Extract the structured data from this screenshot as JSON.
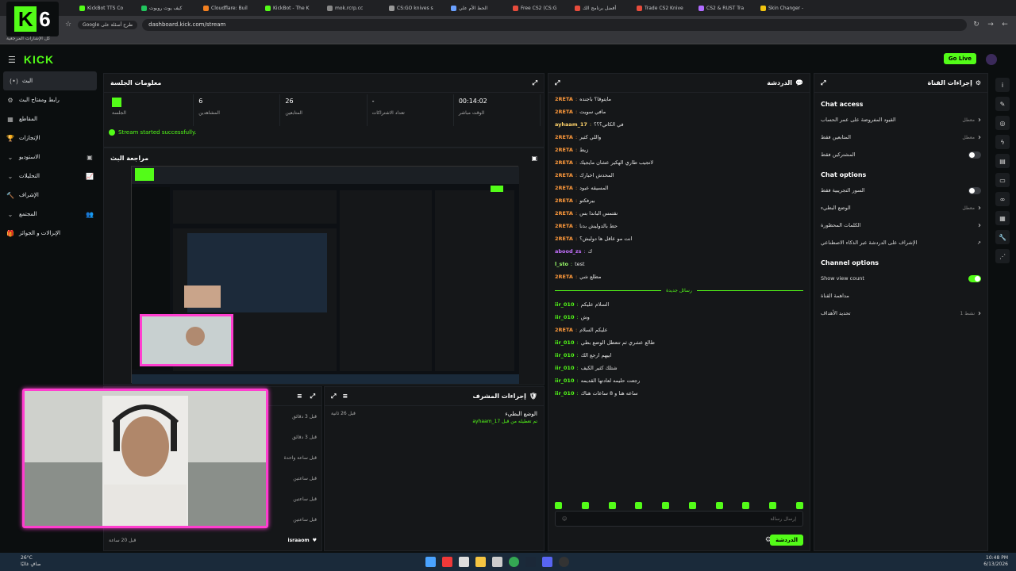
{
  "browser": {
    "tabs": [
      {
        "label": "KickBot TTS Co",
        "color": "#53fc18"
      },
      {
        "label": "كيف يوت روبوت",
        "color": "#21c55d"
      },
      {
        "label": "Cloudflare: Buil",
        "color": "#f38020"
      },
      {
        "label": "KickBot - The K",
        "color": "#53fc18"
      },
      {
        "label": "mok.rcrp.cc",
        "color": "#888888"
      },
      {
        "label": "CS:GO knives s",
        "color": "#999999"
      },
      {
        "label": "الحظ الأم علي",
        "color": "#6aa0ff"
      },
      {
        "label": "Free CS2 (CS:G",
        "color": "#e74c3c"
      },
      {
        "label": "أفضل برنامج الك",
        "color": "#e74c3c"
      },
      {
        "label": "Trade CS2 Knive",
        "color": "#e74c3c"
      },
      {
        "label": "CS2 & RUST Tra",
        "color": "#b06bff"
      },
      {
        "label": "Skin Changer -",
        "color": "#f1c40f"
      }
    ],
    "url": "dashboard.kick.com/stream",
    "google_hint": "Google طرح أسئلة على",
    "bookmarks_label": "كل الإشارات المرجعية"
  },
  "overlay_logo": {
    "letter": "K",
    "number": "6"
  },
  "topbar": {
    "brand": "KICK",
    "golive": "Go Live"
  },
  "sidebar": {
    "items": [
      {
        "label": "البث",
        "icon": "(•)",
        "active": true,
        "chevron": false
      },
      {
        "label": "رابط ومفتاح البث",
        "icon": "⚙",
        "chevron": false
      },
      {
        "label": "المقاطع",
        "icon": "▦",
        "chevron": false
      },
      {
        "label": "الإنجازات",
        "icon": "🏆",
        "chevron": false
      },
      {
        "label": "الاستوديو",
        "icon": "▣",
        "chevron": true
      },
      {
        "label": "التحليلات",
        "icon": "📈",
        "chevron": true
      },
      {
        "label": "الإشراف",
        "icon": "🔨",
        "chevron": false
      },
      {
        "label": "المجتمع",
        "icon": "👥",
        "chevron": true
      },
      {
        "label": "الإنزالات و الجوائز",
        "icon": "🎁",
        "chevron": false
      }
    ]
  },
  "session": {
    "title": "معلومات الجلسة",
    "stats": [
      {
        "value": "",
        "label": "الجلسة"
      },
      {
        "value": "6",
        "label": "المشاهدين"
      },
      {
        "value": "26",
        "label": "المتابعين"
      },
      {
        "value": "-",
        "label": "تعداد الاشتراكات"
      },
      {
        "value": "00:14:02",
        "label": "الوقت مباشر"
      }
    ],
    "success": "Stream started successfully."
  },
  "preview": {
    "title": "مراجعة البث"
  },
  "events_panel": {
    "rows": [
      {
        "time": "قبل 3 دقائق"
      },
      {
        "time": "قبل 3 دقائق"
      },
      {
        "time": "قبل ساعة واحدة"
      },
      {
        "time": "قبل ساعتين"
      },
      {
        "time": "قبل ساعتين"
      },
      {
        "time": "قبل ساعتين"
      }
    ],
    "last_user": "israaom",
    "last_time": "قبل 20 ساعة"
  },
  "mod_actions": {
    "title": "إجراءات المشرف",
    "item_title": "الوضع البطيء",
    "item_sub": "ayhaam_17 تم تعطيله من قبل",
    "item_time": "قبل 26 ثانية"
  },
  "chat": {
    "title": "الدردشة",
    "messages": [
      {
        "user": "2RETA",
        "text": "مايتوقا؟ باجنده",
        "color": "#ff9a3c"
      },
      {
        "user": "2RETA",
        "text": "مافي سويت",
        "color": "#ff9a3c"
      },
      {
        "user": "ayhaam_17",
        "text": "في الكاتي؟؟؟",
        "color": "#ffd36b"
      },
      {
        "user": "2RETA",
        "text": "واللي كثير",
        "color": "#ff9a3c"
      },
      {
        "user": "2RETA",
        "text": "زيط",
        "color": "#ff9a3c"
      },
      {
        "user": "2RETA",
        "text": "لاتجيب طاري الهكير عشان مايجيك",
        "color": "#ff9a3c"
      },
      {
        "user": "2RETA",
        "text": "المحدش اخبارك",
        "color": "#ff9a3c"
      },
      {
        "user": "2RETA",
        "text": "المسيقه عبود",
        "color": "#ff9a3c"
      },
      {
        "user": "2RETA",
        "text": "بيرفكتو",
        "color": "#ff9a3c"
      },
      {
        "user": "2RETA",
        "text": "نقتمس الباندا بس",
        "color": "#ff9a3c"
      },
      {
        "user": "2RETA",
        "text": "حط بالدوليش بدنا",
        "color": "#ff9a3c"
      },
      {
        "user": "2RETA",
        "text": "انت مو عاقل ها دوليش؟",
        "color": "#ff9a3c"
      },
      {
        "user": "abood_zs",
        "text": "ك",
        "color": "#c471ff"
      },
      {
        "user": "l_sto",
        "text": "test",
        "color": "#9cff6b"
      },
      {
        "user": "2RETA",
        "text": "مطلع شي",
        "color": "#ff9a3c"
      }
    ],
    "divider": "رسائل جديدة",
    "new_messages": [
      {
        "user": "iir_010",
        "text": "السلام عليكم",
        "color": "#53fc18"
      },
      {
        "user": "iir_010",
        "text": "وش",
        "color": "#53fc18"
      },
      {
        "user": "2RETA",
        "text": "عليكم السلام",
        "color": "#ff9a3c"
      },
      {
        "user": "iir_010",
        "text": "طالع عشري ثم تتعطل الوضع بطي",
        "color": "#53fc18"
      },
      {
        "user": "iir_010",
        "text": "ابيهم ارجع الك",
        "color": "#53fc18"
      },
      {
        "user": "iir_010",
        "text": "شتلك كثير الكيف",
        "color": "#53fc18"
      },
      {
        "user": "iir_010",
        "text": "رجعت حليمه لعادتها القديمه",
        "color": "#53fc18"
      },
      {
        "user": "iir_010",
        "text": "ساعه هنا و 8 ساعات هناك",
        "color": "#53fc18"
      }
    ],
    "input_placeholder": "إرسال رسالة",
    "send_label": "الدردشة"
  },
  "channel": {
    "title": "إجراءات القناة",
    "sections": [
      {
        "heading": "Chat access",
        "options": [
          {
            "label": "القيود المفروضة على عمر الحساب",
            "right": "معطل",
            "type": "chevron"
          },
          {
            "label": "المتابعين فقط",
            "right": "معطل",
            "type": "chevron"
          },
          {
            "label": "المشتركين فقط",
            "right": "",
            "type": "toggle",
            "on": false
          }
        ]
      },
      {
        "heading": "Chat options",
        "options": [
          {
            "label": "السور التجريبية فقط",
            "right": "",
            "type": "toggle",
            "on": false
          },
          {
            "label": "الوضع البطيء",
            "right": "معطل",
            "type": "chevron"
          },
          {
            "label": "الكلمات المحظورة",
            "right": "",
            "type": "chevron"
          },
          {
            "label": "الإشراف على الدردشة عبر الذكاء الاصطناعي",
            "right": "",
            "type": "link"
          }
        ]
      },
      {
        "heading": "Channel options",
        "options": [
          {
            "label": "Show view count",
            "right": "",
            "type": "toggle",
            "on": true
          },
          {
            "label": "مداهمة القناة",
            "right": "",
            "type": "none"
          },
          {
            "label": "تحديد الأهداف",
            "right": "نشط 1",
            "type": "chevron"
          }
        ]
      }
    ]
  },
  "taskbar": {
    "weather_temp": "26°C",
    "weather_text": "صافٍ غالبًا",
    "time": "10:48 PM",
    "date": "6/13/2026"
  },
  "colors": {
    "accent": "#53fc18",
    "pink_border": "#ff3ecf"
  }
}
